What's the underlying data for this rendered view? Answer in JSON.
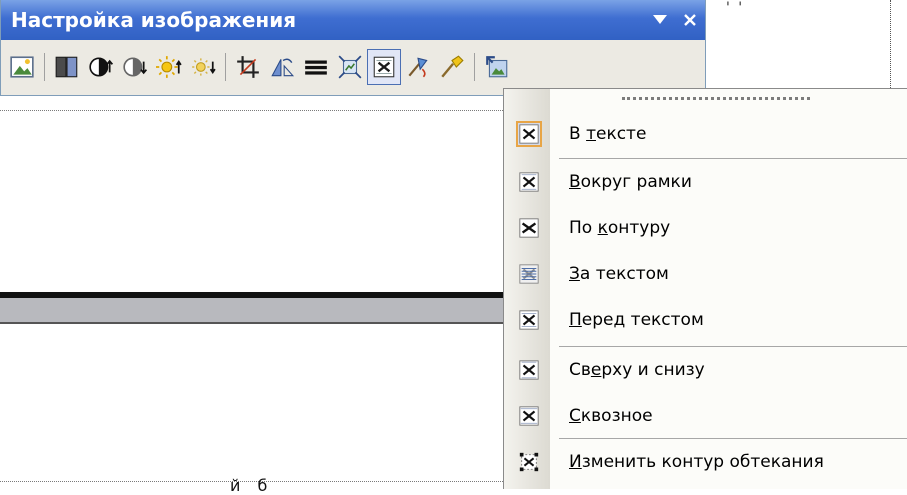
{
  "toolbar": {
    "title": "Настройка изображения",
    "menu_arrow_icon": "triangle-down-icon",
    "close_icon": "close-icon",
    "tools": [
      {
        "name": "insert-picture-icon"
      },
      {
        "sep": true
      },
      {
        "name": "color-icon"
      },
      {
        "name": "more-contrast-icon"
      },
      {
        "name": "less-contrast-icon"
      },
      {
        "name": "more-brightness-icon"
      },
      {
        "name": "less-brightness-icon"
      },
      {
        "sep": true
      },
      {
        "name": "crop-icon"
      },
      {
        "name": "rotate-left-icon"
      },
      {
        "name": "line-style-icon"
      },
      {
        "name": "compress-pictures-icon"
      },
      {
        "name": "text-wrapping-icon",
        "active": true
      },
      {
        "name": "format-picture-icon"
      },
      {
        "name": "set-transparent-color-icon"
      },
      {
        "sep": true
      },
      {
        "name": "reset-picture-icon"
      }
    ]
  },
  "document": {
    "top_fragment": "' '",
    "bottom_fragment": "й         б"
  },
  "wrap_menu": {
    "items": [
      {
        "before": "В ",
        "key": "т",
        "after": "ексте",
        "icon": "in-line-with-text-icon",
        "selected": true
      },
      {
        "before": "",
        "key": "В",
        "after": "округ рамки",
        "icon": "square-wrap-icon"
      },
      {
        "before": "По ",
        "key": "к",
        "after": "онтуру",
        "icon": "tight-wrap-icon"
      },
      {
        "before": "",
        "key": "З",
        "after": "а текстом",
        "icon": "behind-text-icon"
      },
      {
        "before": "",
        "key": "П",
        "after": "еред текстом",
        "icon": "in-front-of-text-icon"
      },
      {
        "before": "Св",
        "key": "е",
        "after": "рху и снизу",
        "icon": "top-bottom-wrap-icon"
      },
      {
        "before": "",
        "key": "С",
        "after": "квозное",
        "icon": "through-wrap-icon"
      },
      {
        "before": "",
        "key": "И",
        "after": "зменить контур обтекания",
        "icon": "edit-wrap-points-icon"
      }
    ]
  }
}
